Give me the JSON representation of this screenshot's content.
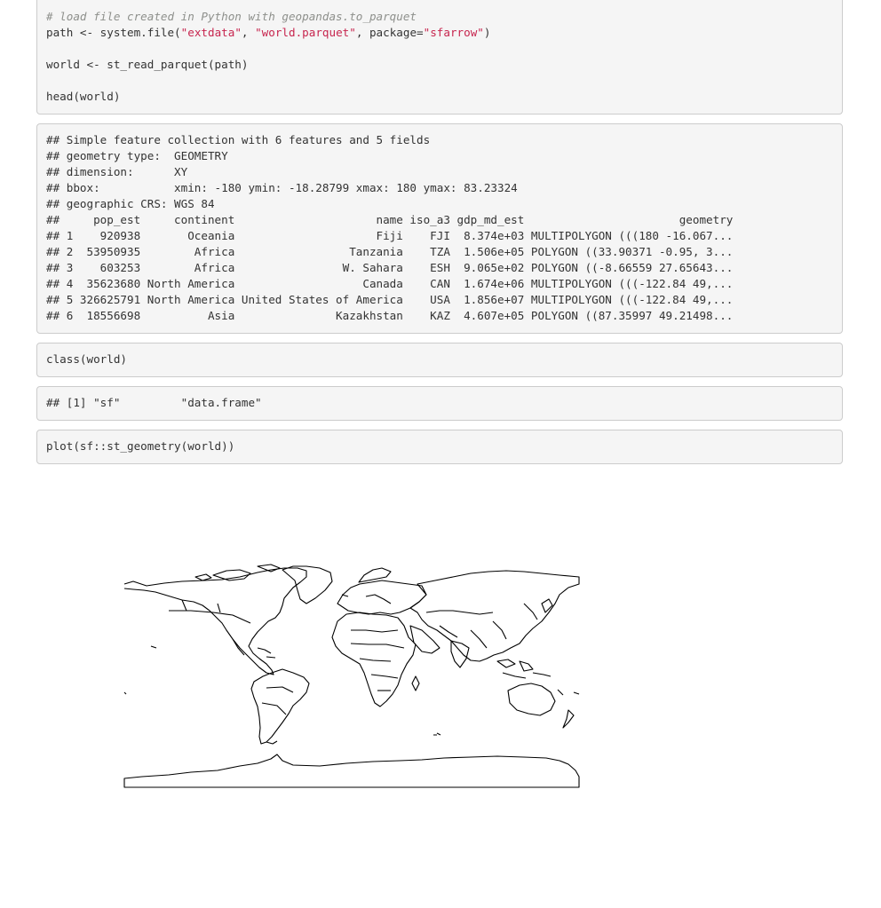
{
  "code_block_1": {
    "comment": "# load file created in Python with geopandas.to_parquet",
    "line2_a": "path <- system.file(",
    "line2_s1": "\"extdata\"",
    "line2_b": ", ",
    "line2_s2": "\"world.parquet\"",
    "line2_c": ", package=",
    "line2_s3": "\"sfarrow\"",
    "line2_d": ")",
    "line3": "world <- st_read_parquet(path)",
    "line4": "head(world)"
  },
  "output_block_1": {
    "lines": [
      "## Simple feature collection with 6 features and 5 fields",
      "## geometry type:  GEOMETRY",
      "## dimension:      XY",
      "## bbox:           xmin: -180 ymin: -18.28799 xmax: 180 ymax: 83.23324",
      "## geographic CRS: WGS 84",
      "##     pop_est     continent                     name iso_a3 gdp_md_est                       geometry",
      "## 1    920938       Oceania                     Fiji    FJI  8.374e+03 MULTIPOLYGON (((180 -16.067...",
      "## 2  53950935        Africa                 Tanzania    TZA  1.506e+05 POLYGON ((33.90371 -0.95, 3...",
      "## 3    603253        Africa                W. Sahara    ESH  9.065e+02 POLYGON ((-8.66559 27.65643...",
      "## 4  35623680 North America                   Canada    CAN  1.674e+06 MULTIPOLYGON (((-122.84 49,...",
      "## 5 326625791 North America United States of America    USA  1.856e+07 MULTIPOLYGON (((-122.84 49,...",
      "## 6  18556698          Asia               Kazakhstan    KAZ  4.607e+05 POLYGON ((87.35997 49.21498..."
    ]
  },
  "code_block_2": {
    "line": "class(world)"
  },
  "output_block_2": {
    "line": "## [1] \"sf\"         \"data.frame\""
  },
  "code_block_3": {
    "line": "plot(sf::st_geometry(world))"
  },
  "colors": {
    "block_bg": "#f5f5f5",
    "block_border": "#cccccc",
    "comment": "#8e908c",
    "string": "#c7254e",
    "text": "#333333",
    "map_stroke": "#000000"
  },
  "figure": {
    "type": "world-map-outline",
    "description_icon": "world-map-icon"
  }
}
